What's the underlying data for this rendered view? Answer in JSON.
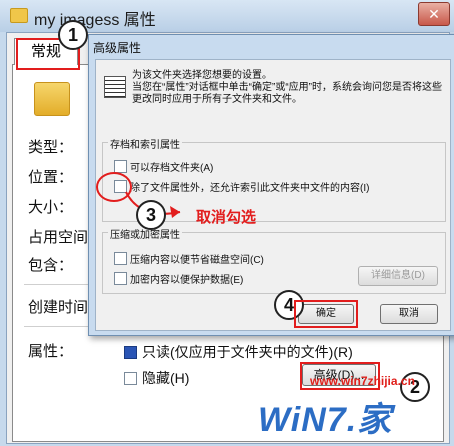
{
  "outer_window": {
    "title": "my imagess 属性",
    "close_glyph": "✕",
    "tab": "常规",
    "labels": [
      "类型：",
      "位置：",
      "大小：",
      "占用空间",
      "包含：",
      "创建时间",
      "属性："
    ],
    "readonly_checkbox": "只读(仅应用于文件夹中的文件)(R)",
    "hidden_checkbox": "隐藏(H)",
    "advanced_button": "高级(D)..."
  },
  "advanced_dialog": {
    "title": "高级属性",
    "description": "为该文件夹选择您想要的设置。\n当您在“属性”对话框中单击“确定”或“应用”时，系统会询问您是否将这些更改同时应用于所有子文件夹和文件。",
    "archive_group": "存档和索引属性",
    "archive_checkbox": "可以存档文件夹(A)",
    "index_checkbox": "除了文件属性外，还允许索引此文件夹中文件的内容(I)",
    "compress_group": "压缩或加密属性",
    "compress_checkbox": "压缩内容以便节省磁盘空间(C)",
    "encrypt_checkbox": "加密内容以便保护数据(E)",
    "details_button": "详细信息(D)",
    "ok_button": "确定",
    "cancel_button": "取消"
  },
  "annotations": {
    "step1": "1",
    "step2": "2",
    "step3": "3",
    "step4": "4",
    "step3_note": "取消勾选",
    "highlight_color": "#e21d1d"
  },
  "watermark": {
    "url": "www.win7zhijia.cn",
    "logo": "WiN7.家"
  }
}
